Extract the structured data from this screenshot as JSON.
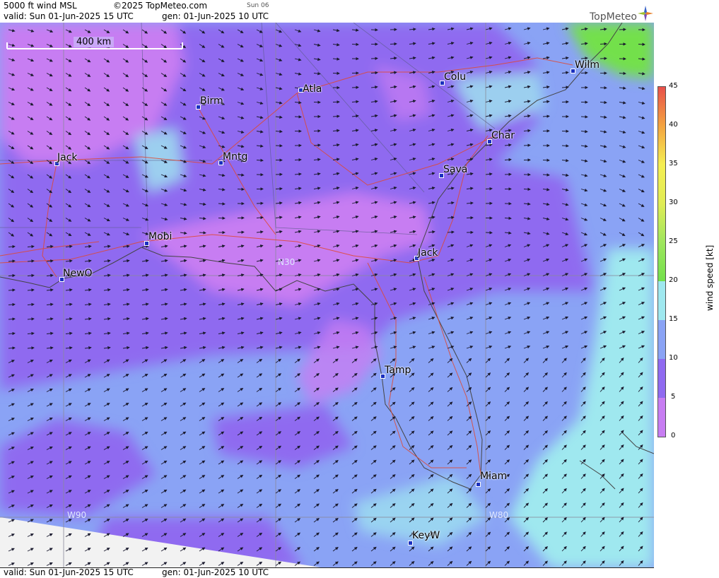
{
  "header": {
    "product": "5000 ft wind MSL",
    "copyright": "©2025 TopMeteo.com",
    "day_short": "Sun 06",
    "valid": "valid:  Sun  01-Jun-2025  15 UTC",
    "generated": "gen: 01-Jun-2025 10 UTC"
  },
  "footer": {
    "valid": "valid:  Sun  01-Jun-2025  15 UTC",
    "generated": "gen: 01-Jun-2025 10 UTC"
  },
  "logo": {
    "text": "TopMeteo"
  },
  "scale_bar": {
    "label": "400 km"
  },
  "grid_labels": {
    "lat": "N30",
    "lon_w90": "W90",
    "lon_w80": "W80"
  },
  "cities": {
    "atla": "Atla",
    "birm": "Birm",
    "colu": "Colu",
    "wilm": "Wilm",
    "char": "Char",
    "jack_ms": "Jack",
    "mntg": "Mntg",
    "sava": "Sava",
    "mobi": "Mobi",
    "jack_fl": "Jack",
    "newo": "NewO",
    "tamp": "Tamp",
    "miam": "Miam",
    "keyw": "KeyW"
  },
  "legend": {
    "title": "wind speed [kt]",
    "ticks": [
      "45",
      "40",
      "35",
      "30",
      "25",
      "20",
      "15",
      "10",
      "5",
      "0"
    ],
    "colors": {
      "c0": "#c77df2",
      "c5": "#8f6af0",
      "c10": "#8aa3f5",
      "c15": "#9fe8ef",
      "c20": "#73e04c",
      "c25": "#9fe65e",
      "c30": "#e0ec55",
      "c35": "#f5ee52",
      "c40": "#f3a340",
      "c45": "#e8504a"
    }
  }
}
